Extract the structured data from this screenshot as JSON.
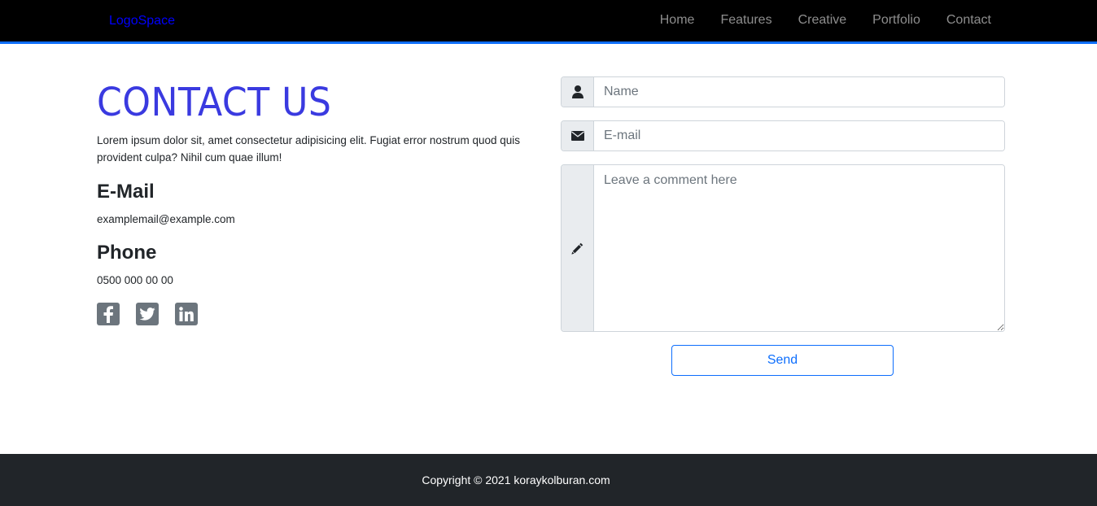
{
  "navbar": {
    "brand": "LogoSpace",
    "links": [
      "Home",
      "Features",
      "Creative",
      "Portfolio",
      "Contact"
    ],
    "accent_color": "#0d6efd"
  },
  "contact": {
    "title": "CONTACT US",
    "description": "Lorem ipsum dolor sit, amet consectetur adipisicing elit. Fugiat error nostrum quod quis provident culpa? Nihil cum quae illum!",
    "email_heading": "E-Mail",
    "email_value": "examplemail@example.com",
    "phone_heading": "Phone",
    "phone_value": "0500 000 00 00",
    "social_icons": [
      "facebook-icon",
      "twitter-icon",
      "linkedin-icon"
    ]
  },
  "form": {
    "name_placeholder": "Name",
    "email_placeholder": "E-mail",
    "comment_placeholder": "Leave a comment here",
    "send_label": "Send",
    "icons": [
      "user-icon",
      "envelope-icon",
      "pencil-icon"
    ]
  },
  "footer": {
    "copyright": "Copyright © 2021 koraykolburan.com"
  }
}
